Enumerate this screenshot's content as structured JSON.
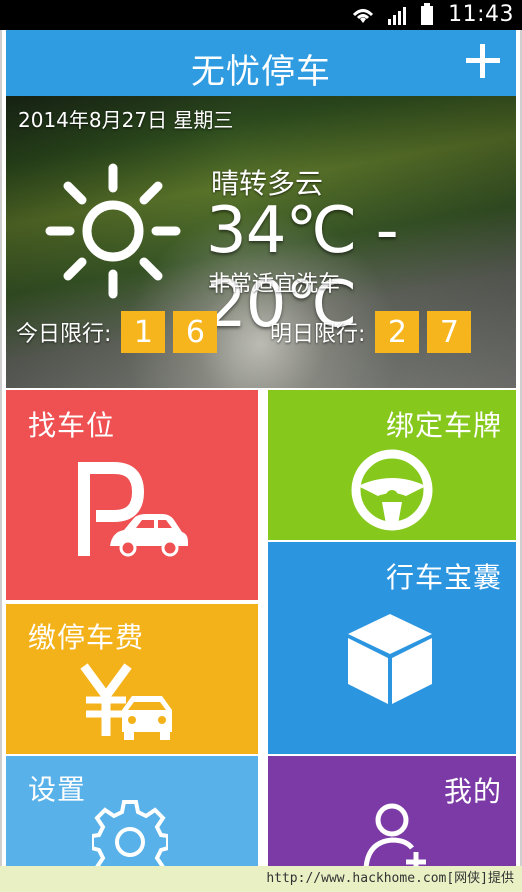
{
  "status_bar": {
    "time": "11:43",
    "icons": [
      "wifi-icon",
      "signal-icon",
      "battery-icon"
    ]
  },
  "header": {
    "title": "无忧停车",
    "add_icon": "plus-icon"
  },
  "weather": {
    "date": "2014年8月27日  星期三",
    "condition": "晴转多云",
    "temperature": "34℃ - 20℃",
    "tip": "非常适宜洗车",
    "today_limit_label": "今日限行:",
    "today_limit_numbers": [
      "1",
      "6"
    ],
    "tomorrow_limit_label": "明日限行:",
    "tomorrow_limit_numbers": [
      "2",
      "7"
    ],
    "icon": "sun-icon"
  },
  "tiles": {
    "find": {
      "label": "找车位",
      "icon": "parking-car-icon",
      "color": "#ef5052"
    },
    "bind": {
      "label": "绑定车牌",
      "icon": "steering-wheel-icon",
      "color": "#86c91c"
    },
    "pay": {
      "label": "缴停车费",
      "icon": "yuan-car-icon",
      "color": "#f4b21a"
    },
    "box": {
      "label": "行车宝囊",
      "icon": "cube-icon",
      "color": "#2b95e0"
    },
    "settings": {
      "label": "设置",
      "icon": "gear-icon",
      "color": "#58b2e9"
    },
    "me": {
      "label": "我的",
      "icon": "user-add-icon",
      "color": "#7b3aa5"
    }
  },
  "footer": {
    "text": "http://www.hackhome.com[网侠]提供"
  }
}
